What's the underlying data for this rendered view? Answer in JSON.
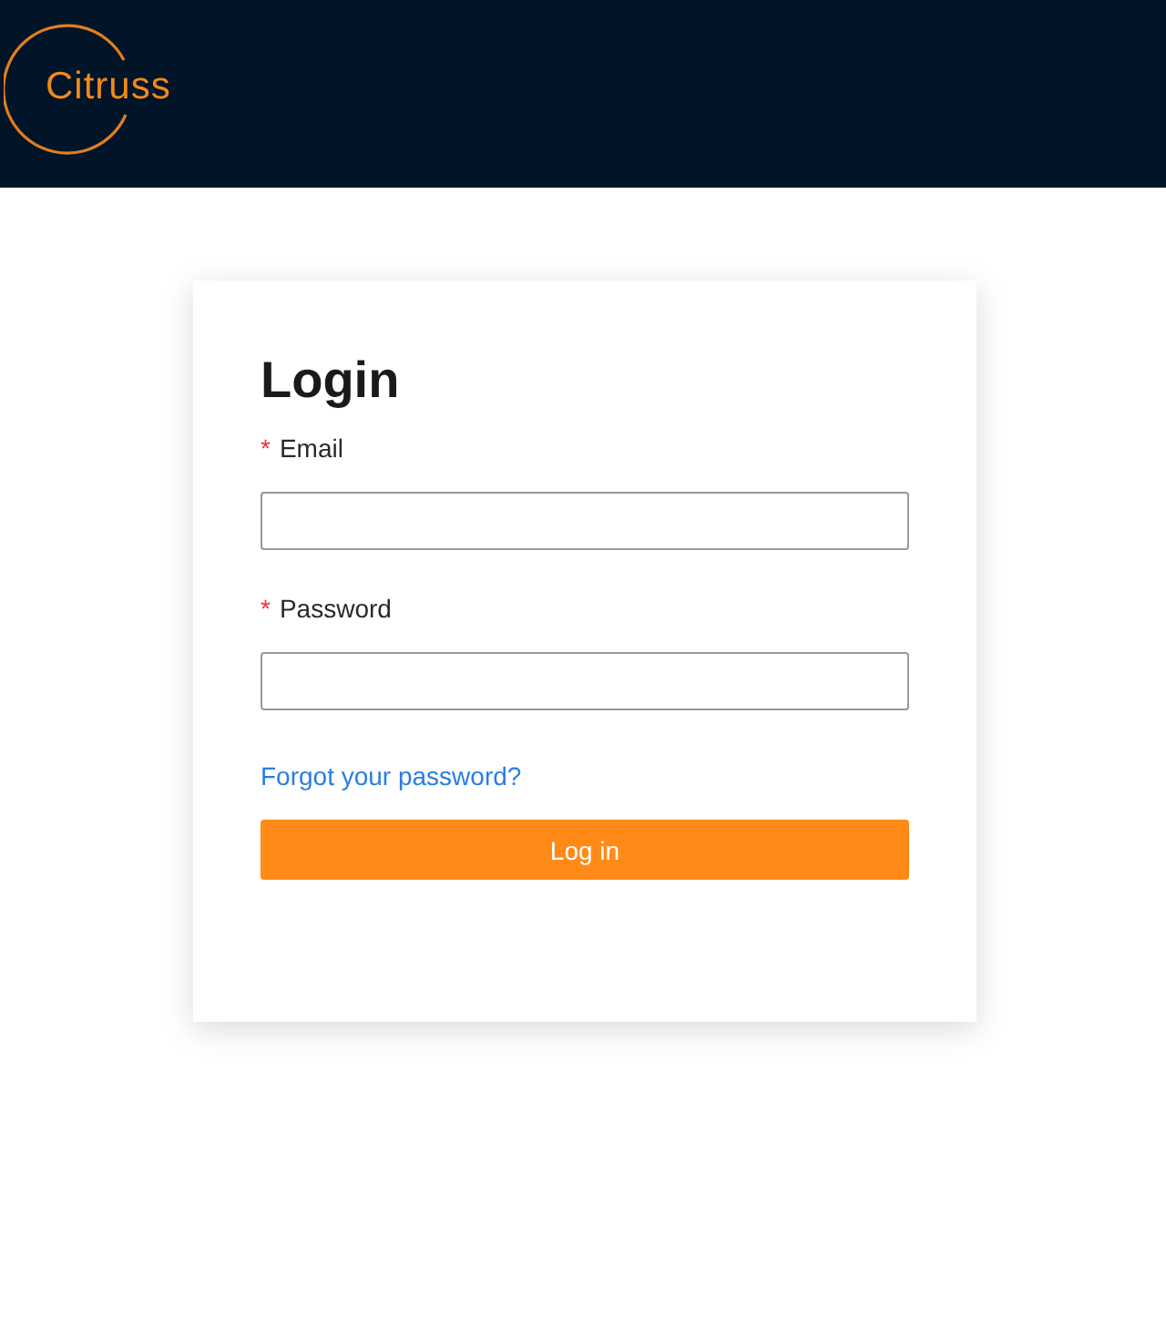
{
  "header": {
    "logo": "Citruss"
  },
  "login": {
    "title": "Login",
    "fields": [
      {
        "label": "Email",
        "required_mark": "*"
      },
      {
        "label": "Password",
        "required_mark": "*"
      }
    ],
    "forgot_link": "Forgot your password?",
    "submit": "Log in"
  }
}
